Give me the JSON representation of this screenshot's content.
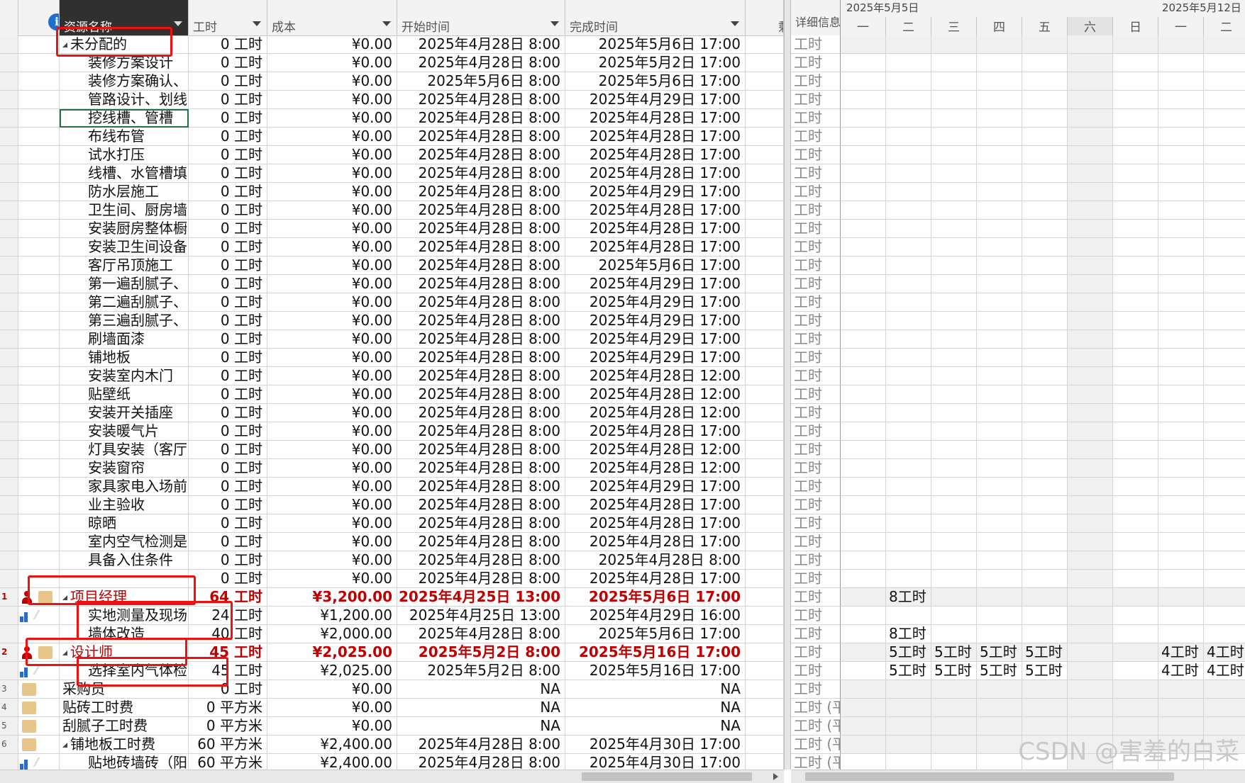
{
  "columns": {
    "resource_name": "资源名称",
    "work": "工时",
    "cost": "成本",
    "start": "开始时间",
    "finish": "完成时间",
    "truncated": "剩",
    "details": "详细信息"
  },
  "timescale": {
    "week1": "2025年5月5日",
    "week2": "2025年5月12日",
    "days": [
      "一",
      "二",
      "三",
      "四",
      "五",
      "六",
      "日",
      "一",
      "二"
    ]
  },
  "rows": [
    {
      "rn": "",
      "icon": "",
      "level": 0,
      "name": "未分配的",
      "expand": true,
      "work": "0 工时",
      "cost": "¥0.00",
      "start": "2025年4月28日 8:00",
      "finish": "2025年5月6日 17:00",
      "detail": "工时",
      "cells": []
    },
    {
      "rn": "",
      "icon": "",
      "level": 1,
      "name": "装修方案设计",
      "work": "0 工时",
      "cost": "¥0.00",
      "start": "2025年4月28日 8:00",
      "finish": "2025年5月2日 17:00",
      "detail": "工时",
      "cells": []
    },
    {
      "rn": "",
      "icon": "",
      "level": 1,
      "name": "装修方案确认、",
      "work": "0 工时",
      "cost": "¥0.00",
      "start": "2025年5月6日 8:00",
      "finish": "2025年5月6日 17:00",
      "detail": "工时",
      "cells": []
    },
    {
      "rn": "",
      "icon": "",
      "level": 1,
      "name": "管路设计、划线",
      "work": "0 工时",
      "cost": "¥0.00",
      "start": "2025年4月28日 8:00",
      "finish": "2025年4月29日 17:00",
      "detail": "工时",
      "cells": []
    },
    {
      "rn": "",
      "icon": "",
      "level": 1,
      "name": "挖线槽、管槽",
      "work": "0 工时",
      "cost": "¥0.00",
      "start": "2025年4月28日 8:00",
      "finish": "2025年4月28日 17:00",
      "detail": "工时",
      "cells": [],
      "selected": true
    },
    {
      "rn": "",
      "icon": "",
      "level": 1,
      "name": "布线布管",
      "work": "0 工时",
      "cost": "¥0.00",
      "start": "2025年4月28日 8:00",
      "finish": "2025年4月28日 17:00",
      "detail": "工时",
      "cells": []
    },
    {
      "rn": "",
      "icon": "",
      "level": 1,
      "name": "试水打压",
      "work": "0 工时",
      "cost": "¥0.00",
      "start": "2025年4月28日 8:00",
      "finish": "2025年4月28日 17:00",
      "detail": "工时",
      "cells": []
    },
    {
      "rn": "",
      "icon": "",
      "level": 1,
      "name": "线槽、水管槽填",
      "work": "0 工时",
      "cost": "¥0.00",
      "start": "2025年4月28日 8:00",
      "finish": "2025年4月28日 17:00",
      "detail": "工时",
      "cells": []
    },
    {
      "rn": "",
      "icon": "",
      "level": 1,
      "name": "防水层施工",
      "work": "0 工时",
      "cost": "¥0.00",
      "start": "2025年4月28日 8:00",
      "finish": "2025年4月29日 17:00",
      "detail": "工时",
      "cells": []
    },
    {
      "rn": "",
      "icon": "",
      "level": 1,
      "name": "卫生间、厨房墙",
      "work": "0 工时",
      "cost": "¥0.00",
      "start": "2025年4月28日 8:00",
      "finish": "2025年4月28日 17:00",
      "detail": "工时",
      "cells": []
    },
    {
      "rn": "",
      "icon": "",
      "level": 1,
      "name": "安装厨房整体橱",
      "work": "0 工时",
      "cost": "¥0.00",
      "start": "2025年4月28日 8:00",
      "finish": "2025年4月28日 17:00",
      "detail": "工时",
      "cells": []
    },
    {
      "rn": "",
      "icon": "",
      "level": 1,
      "name": "安装卫生间设备",
      "work": "0 工时",
      "cost": "¥0.00",
      "start": "2025年4月28日 8:00",
      "finish": "2025年4月28日 17:00",
      "detail": "工时",
      "cells": []
    },
    {
      "rn": "",
      "icon": "",
      "level": 1,
      "name": "客厅吊顶施工",
      "work": "0 工时",
      "cost": "¥0.00",
      "start": "2025年4月28日 8:00",
      "finish": "2025年5月6日 17:00",
      "detail": "工时",
      "cells": []
    },
    {
      "rn": "",
      "icon": "",
      "level": 1,
      "name": "第一遍刮腻子、",
      "work": "0 工时",
      "cost": "¥0.00",
      "start": "2025年4月28日 8:00",
      "finish": "2025年4月29日 17:00",
      "detail": "工时",
      "cells": []
    },
    {
      "rn": "",
      "icon": "",
      "level": 1,
      "name": "第二遍刮腻子、",
      "work": "0 工时",
      "cost": "¥0.00",
      "start": "2025年4月28日 8:00",
      "finish": "2025年4月29日 17:00",
      "detail": "工时",
      "cells": []
    },
    {
      "rn": "",
      "icon": "",
      "level": 1,
      "name": "第三遍刮腻子、",
      "work": "0 工时",
      "cost": "¥0.00",
      "start": "2025年4月28日 8:00",
      "finish": "2025年4月29日 17:00",
      "detail": "工时",
      "cells": []
    },
    {
      "rn": "",
      "icon": "",
      "level": 1,
      "name": "刷墙面漆",
      "work": "0 工时",
      "cost": "¥0.00",
      "start": "2025年4月28日 8:00",
      "finish": "2025年4月29日 17:00",
      "detail": "工时",
      "cells": []
    },
    {
      "rn": "",
      "icon": "",
      "level": 1,
      "name": "铺地板",
      "work": "0 工时",
      "cost": "¥0.00",
      "start": "2025年4月28日 8:00",
      "finish": "2025年4月29日 17:00",
      "detail": "工时",
      "cells": []
    },
    {
      "rn": "",
      "icon": "",
      "level": 1,
      "name": "安装室内木门",
      "work": "0 工时",
      "cost": "¥0.00",
      "start": "2025年4月28日 8:00",
      "finish": "2025年4月28日 12:00",
      "detail": "工时",
      "cells": []
    },
    {
      "rn": "",
      "icon": "",
      "level": 1,
      "name": "贴壁纸",
      "work": "0 工时",
      "cost": "¥0.00",
      "start": "2025年4月28日 8:00",
      "finish": "2025年4月28日 12:00",
      "detail": "工时",
      "cells": []
    },
    {
      "rn": "",
      "icon": "",
      "level": 1,
      "name": "安装开关插座",
      "work": "0 工时",
      "cost": "¥0.00",
      "start": "2025年4月28日 8:00",
      "finish": "2025年4月28日 12:00",
      "detail": "工时",
      "cells": []
    },
    {
      "rn": "",
      "icon": "",
      "level": 1,
      "name": "安装暖气片",
      "work": "0 工时",
      "cost": "¥0.00",
      "start": "2025年4月28日 8:00",
      "finish": "2025年4月28日 17:00",
      "detail": "工时",
      "cells": []
    },
    {
      "rn": "",
      "icon": "",
      "level": 1,
      "name": "灯具安装（客厅",
      "work": "0 工时",
      "cost": "¥0.00",
      "start": "2025年4月28日 8:00",
      "finish": "2025年4月28日 12:00",
      "detail": "工时",
      "cells": []
    },
    {
      "rn": "",
      "icon": "",
      "level": 1,
      "name": "安装窗帘",
      "work": "0 工时",
      "cost": "¥0.00",
      "start": "2025年4月28日 8:00",
      "finish": "2025年4月28日 12:00",
      "detail": "工时",
      "cells": []
    },
    {
      "rn": "",
      "icon": "",
      "level": 1,
      "name": "家具家电入场前",
      "work": "0 工时",
      "cost": "¥0.00",
      "start": "2025年4月28日 8:00",
      "finish": "2025年4月29日 17:00",
      "detail": "工时",
      "cells": []
    },
    {
      "rn": "",
      "icon": "",
      "level": 1,
      "name": "业主验收",
      "work": "0 工时",
      "cost": "¥0.00",
      "start": "2025年4月28日 8:00",
      "finish": "2025年4月28日 17:00",
      "detail": "工时",
      "cells": []
    },
    {
      "rn": "",
      "icon": "",
      "level": 1,
      "name": "晾晒",
      "work": "0 工时",
      "cost": "¥0.00",
      "start": "2025年4月28日 8:00",
      "finish": "2025年4月28日 17:00",
      "detail": "工时",
      "cells": []
    },
    {
      "rn": "",
      "icon": "",
      "level": 1,
      "name": "室内空气检测是",
      "work": "0 工时",
      "cost": "¥0.00",
      "start": "2025年4月28日 8:00",
      "finish": "2025年4月28日 17:00",
      "detail": "工时",
      "cells": []
    },
    {
      "rn": "",
      "icon": "",
      "level": 1,
      "name": "具备入住条件",
      "work": "0 工时",
      "cost": "¥0.00",
      "start": "2025年4月28日 8:00",
      "finish": "2025年4月28日 8:00",
      "detail": "工时",
      "cells": []
    },
    {
      "rn": "",
      "icon": "",
      "level": 1,
      "name": "",
      "work": "0 工时",
      "cost": "¥0.00",
      "start": "2025年4月28日 8:00",
      "finish": "2025年4月28日 17:00",
      "detail": "工时",
      "cells": []
    },
    {
      "rn": "1",
      "icon": "person",
      "level": 0,
      "name": "项目经理",
      "expand": true,
      "group": true,
      "work": "64 工时",
      "cost": "¥3,200.00",
      "start": "2025年4月25日 13:00",
      "finish": "2025年5月6日 17:00",
      "detail": "工时",
      "cells": [
        "",
        "8工时",
        "",
        "",
        "",
        "",
        "",
        "",
        ""
      ]
    },
    {
      "rn": "",
      "icon": "assign",
      "level": 1,
      "name": "实地测量及现场",
      "work": "24 工时",
      "cost": "¥1,200.00",
      "start": "2025年4月25日 13:00",
      "finish": "2025年4月29日 16:00",
      "detail": "工时",
      "cells": []
    },
    {
      "rn": "",
      "icon": "",
      "level": 1,
      "name": "墙体改造",
      "work": "40 工时",
      "cost": "¥2,000.00",
      "start": "2025年4月28日 8:00",
      "finish": "2025年5月6日 17:00",
      "detail": "工时",
      "cells": [
        "",
        "8工时",
        "",
        "",
        "",
        "",
        "",
        "",
        ""
      ]
    },
    {
      "rn": "2",
      "icon": "person",
      "level": 0,
      "name": "设计师",
      "expand": true,
      "group": true,
      "work": "45 工时",
      "cost": "¥2,025.00",
      "start": "2025年5月2日 8:00",
      "finish": "2025年5月16日 17:00",
      "detail": "工时",
      "cells": [
        "",
        "5工时",
        "5工时",
        "5工时",
        "5工时",
        "",
        "",
        "4工时",
        "4工时"
      ]
    },
    {
      "rn": "",
      "icon": "assign",
      "level": 1,
      "name": "选择室内气体检",
      "work": "45 工时",
      "cost": "¥2,025.00",
      "start": "2025年5月2日 8:00",
      "finish": "2025年5月16日 17:00",
      "detail": "工时",
      "cells": [
        "",
        "5工时",
        "5工时",
        "5工时",
        "5工时",
        "",
        "",
        "4工时",
        "4工时"
      ]
    },
    {
      "rn": "3",
      "icon": "res",
      "level": 0,
      "name": "采购员",
      "work": "0 工时",
      "cost": "¥0.00",
      "start": "NA",
      "finish": "NA",
      "detail": "工时",
      "cells": []
    },
    {
      "rn": "4",
      "icon": "res",
      "level": 0,
      "name": "贴砖工时费",
      "work": "0 平方米",
      "cost": "¥0.00",
      "start": "NA",
      "finish": "NA",
      "detail": "工时 (平",
      "cells": []
    },
    {
      "rn": "5",
      "icon": "res",
      "level": 0,
      "name": "刮腻子工时费",
      "work": "0 平方米",
      "cost": "¥0.00",
      "start": "NA",
      "finish": "NA",
      "detail": "工时 (平",
      "cells": []
    },
    {
      "rn": "6",
      "icon": "res",
      "level": 0,
      "name": "铺地板工时费",
      "expand": true,
      "work": "60 平方米",
      "cost": "¥2,400.00",
      "start": "2025年4月28日 8:00",
      "finish": "2025年4月30日 17:00",
      "detail": "工时 (平",
      "cells": []
    },
    {
      "rn": "",
      "icon": "assign",
      "level": 1,
      "name": "贴地砖墙砖（阳",
      "work": "60 平方米",
      "cost": "¥2,400.00",
      "start": "2025年4月28日 8:00",
      "finish": "2025年4月30日 17:00",
      "detail": "工时 (平",
      "cells": []
    }
  ],
  "watermark": "CSDN @害羞的白菜"
}
